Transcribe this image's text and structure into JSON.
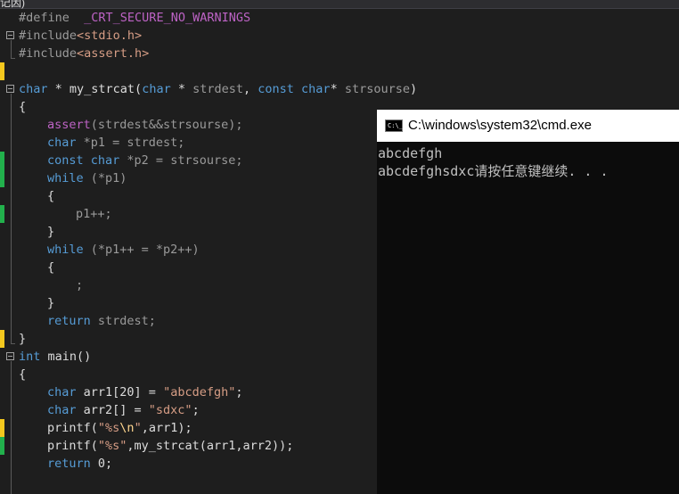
{
  "window_title_fragment": "记因)",
  "code": {
    "l0": [
      "#define",
      "  _CRT_SECURE_NO_WARNINGS"
    ],
    "l1": [
      "#include",
      "<stdio.h>"
    ],
    "l2": [
      "#include",
      "<assert.h>"
    ],
    "l4": [
      "char",
      " * my_strcat(",
      "char",
      " * ",
      "strdest",
      ", ",
      "const",
      " ",
      "char",
      "* ",
      "strsourse",
      ")"
    ],
    "l5": [
      "{"
    ],
    "l6": [
      "assert",
      "(strdest&&strsourse);"
    ],
    "l7": [
      "char",
      " *p1 = strdest;"
    ],
    "l8": [
      "const",
      " ",
      "char",
      " *p2 = strsourse;"
    ],
    "l9": [
      "while",
      " (*p1)"
    ],
    "l10": [
      "{"
    ],
    "l11": [
      "p1++;"
    ],
    "l12": [
      "}"
    ],
    "l13": [
      "while",
      " (*p1++ = *p2++)"
    ],
    "l14": [
      "{"
    ],
    "l15": [
      ";"
    ],
    "l16": [
      "}"
    ],
    "l17": [
      "return",
      " strdest;"
    ],
    "l18": [
      "}"
    ],
    "l19": [
      "int",
      " main()"
    ],
    "l20": [
      "{"
    ],
    "l21": [
      "char",
      " arr1[20] = ",
      "\"abcdefgh\"",
      ";"
    ],
    "l22": [
      "char",
      " arr2[] = ",
      "\"sdxc\"",
      ";"
    ],
    "l23": [
      "printf(",
      "\"%s",
      "\\n",
      "\"",
      ",arr1);"
    ],
    "l24": [
      "printf(",
      "\"%s\"",
      ",my_strcat(arr1,arr2));"
    ],
    "l25": [
      "return",
      " 0;"
    ]
  },
  "console": {
    "title": "C:\\windows\\system32\\cmd.exe",
    "icon_text": "C:\\_",
    "output": [
      "abcdefgh",
      "abcdefghsdxc请按任意键继续. . ."
    ]
  },
  "colors": {
    "editor_bg": "#1e1e1e",
    "keyword": "#569cd6",
    "string": "#d69d85",
    "macro": "#bd63c5",
    "change_saved": "#22b14c",
    "change_unsaved": "#f4c81e",
    "console_bg": "#0c0c0c"
  }
}
